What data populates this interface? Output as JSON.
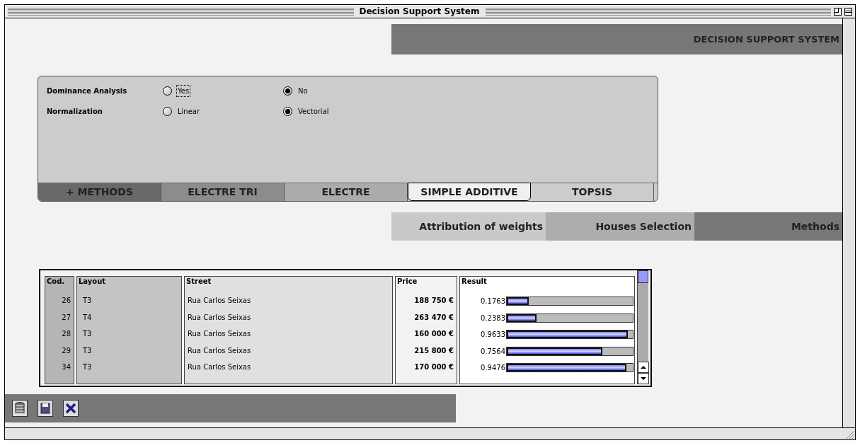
{
  "window": {
    "title": "Decision Support System"
  },
  "header": {
    "title": "DECISION SUPPORT SYSTEM"
  },
  "options": [
    {
      "label": "Dominance Analysis",
      "choices": [
        {
          "label": "Yes",
          "selected": false,
          "focused": true
        },
        {
          "label": "No",
          "selected": true,
          "focused": false
        }
      ]
    },
    {
      "label": "Normalization",
      "choices": [
        {
          "label": "Linear",
          "selected": false,
          "focused": false
        },
        {
          "label": "Vectorial",
          "selected": true,
          "focused": false
        }
      ]
    }
  ],
  "method_tabs": [
    {
      "label": "+ METHODS",
      "selected": false,
      "color": "#686868"
    },
    {
      "label": "ELECTRE TRI",
      "selected": false,
      "color": "#8c8c8c"
    },
    {
      "label": "ELECTRE",
      "selected": false,
      "color": "#ababab"
    },
    {
      "label": "SIMPLE ADDITIVE",
      "selected": true,
      "color": "#f0f0f0"
    },
    {
      "label": "TOPSIS",
      "selected": false,
      "color": "#cccccc"
    }
  ],
  "nav_tabs": [
    {
      "label": "Attribution of weights",
      "color": "#c9c9c9"
    },
    {
      "label": "Houses Selection",
      "color": "#adadad"
    },
    {
      "label": "Methods",
      "color": "#777777"
    }
  ],
  "table": {
    "columns": [
      "Cod.",
      "Layout",
      "Street",
      "Price",
      "Result"
    ],
    "rows": [
      {
        "cod": "26",
        "layout": "T3",
        "street": "Rua Carlos Seixas",
        "price": "188 750 €",
        "result": "0.1763",
        "level": 0.1763
      },
      {
        "cod": "27",
        "layout": "T4",
        "street": "Rua Carlos Seixas",
        "price": "263 470 €",
        "result": "0.2383",
        "level": 0.2383
      },
      {
        "cod": "28",
        "layout": "T3",
        "street": "Rua Carlos Seixas",
        "price": "160 000 €",
        "result": "0.9633",
        "level": 0.9633
      },
      {
        "cod": "29",
        "layout": "T3",
        "street": "Rua Carlos Seixas",
        "price": "215 800 €",
        "result": "0.7564",
        "level": 0.7564
      },
      {
        "cod": "34",
        "layout": "T3",
        "street": "Rua Carlos Seixas",
        "price": "170 000 €",
        "result": "0.9476",
        "level": 0.9476
      }
    ]
  }
}
